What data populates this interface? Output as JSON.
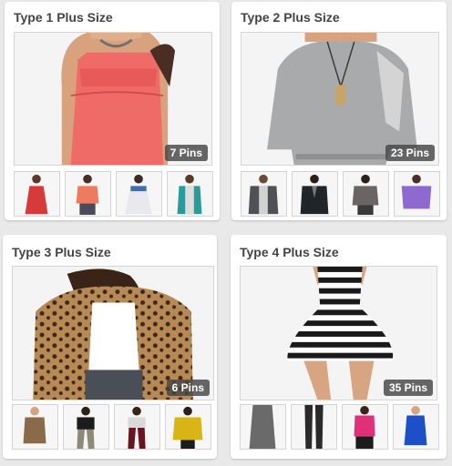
{
  "boards": [
    {
      "title": "Type 1 Plus Size",
      "pin_count": "7 Pins"
    },
    {
      "title": "Type 2 Plus Size",
      "pin_count": "23 Pins"
    },
    {
      "title": "Type 3 Plus Size",
      "pin_count": "6 Pins"
    },
    {
      "title": "Type 4 Plus Size",
      "pin_count": "35 Pins"
    }
  ],
  "colors": {
    "background": "#e9e9e9",
    "card": "#ffffff",
    "badge": "#464646",
    "title": "#444444"
  }
}
